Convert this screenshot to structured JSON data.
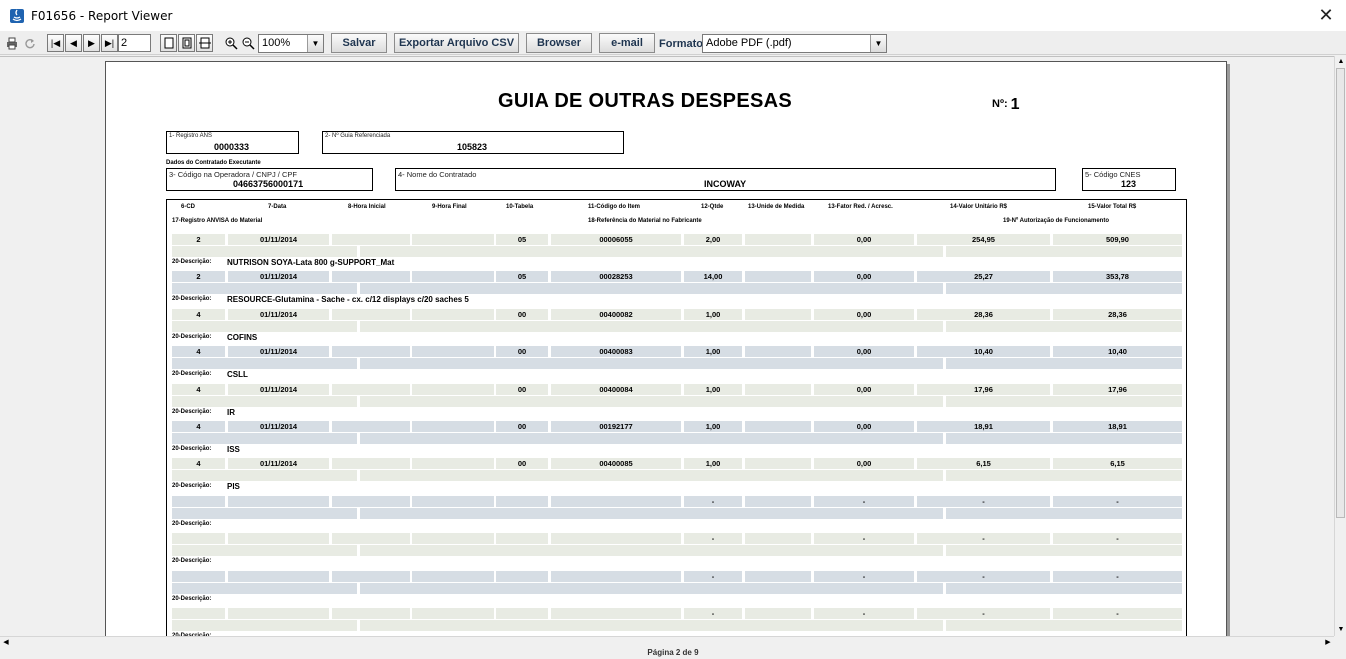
{
  "window": {
    "title": "F01656 - Report Viewer"
  },
  "toolbar": {
    "page_value": "2",
    "zoom_value": "100%",
    "save_label": "Salvar",
    "export_csv_label": "Exportar Arquivo CSV",
    "browser_label": "Browser",
    "email_label": "e-mail",
    "format_label": "Formato:",
    "format_value": "Adobe PDF (.pdf)"
  },
  "report": {
    "title": "GUIA DE OUTRAS DESPESAS",
    "number_label": "Nº:",
    "number_value": "1",
    "registro_ans_label": "1- Registro ANS",
    "registro_ans_value": "0000333",
    "guia_ref_label": "2- Nº Guia Referenciada",
    "guia_ref_value": "105823",
    "contratado_section": "Dados do Contratado Executante",
    "codigo_operadora_label": "3- Código na Operadora / CNPJ / CPF",
    "codigo_operadora_value": "04663756000171",
    "nome_contratado_label": "4- Nome do Contratado",
    "nome_contratado_value": "INCOWAY",
    "cnes_label": "5- Código CNES",
    "cnes_value": "123",
    "headers": {
      "cd": "6-CD",
      "data": "7-Data",
      "hora_ini": "8-Hora Inicial",
      "hora_fim": "9-Hora Final",
      "tabela": "10-Tabela",
      "codigo_item": "11-Código do Item",
      "qtde": "12-Qtde",
      "unidade": "13-Unide de Medida",
      "fator": "13-Fator Red. / Acresc.",
      "valor_unit": "14-Valor Unitário R$",
      "valor_total": "15-Valor Total R$",
      "anvisa": "17-Registro ANVISA do Material",
      "ref_fabricante": "18-Referência do Material no Fabricante",
      "autorizacao": "19-Nº Autorização de Funcionamento"
    },
    "desc_label": "20-Descrição:",
    "items": [
      {
        "cd": "2",
        "data": "01/11/2014",
        "tabela": "05",
        "codigo": "00006055",
        "qtde": "2,00",
        "fator": "0,00",
        "unit": "254,95",
        "total": "509,90",
        "descricao": "NUTRISON SOYA-Lata 800 g-SUPPORT_Mat"
      },
      {
        "cd": "2",
        "data": "01/11/2014",
        "tabela": "05",
        "codigo": "00028253",
        "qtde": "14,00",
        "fator": "0,00",
        "unit": "25,27",
        "total": "353,78",
        "descricao": "RESOURCE-Glutamina - Sache - cx. c/12 displays c/20 saches 5"
      },
      {
        "cd": "4",
        "data": "01/11/2014",
        "tabela": "00",
        "codigo": "00400082",
        "qtde": "1,00",
        "fator": "0,00",
        "unit": "28,36",
        "total": "28,36",
        "descricao": "COFINS"
      },
      {
        "cd": "4",
        "data": "01/11/2014",
        "tabela": "00",
        "codigo": "00400083",
        "qtde": "1,00",
        "fator": "0,00",
        "unit": "10,40",
        "total": "10,40",
        "descricao": "CSLL"
      },
      {
        "cd": "4",
        "data": "01/11/2014",
        "tabela": "00",
        "codigo": "00400084",
        "qtde": "1,00",
        "fator": "0,00",
        "unit": "17,96",
        "total": "17,96",
        "descricao": "IR"
      },
      {
        "cd": "4",
        "data": "01/11/2014",
        "tabela": "00",
        "codigo": "00192177",
        "qtde": "1,00",
        "fator": "0,00",
        "unit": "18,91",
        "total": "18,91",
        "descricao": "ISS"
      },
      {
        "cd": "4",
        "data": "01/11/2014",
        "tabela": "00",
        "codigo": "00400085",
        "qtde": "1,00",
        "fator": "0,00",
        "unit": "6,15",
        "total": "6,15",
        "descricao": "PIS"
      },
      {
        "cd": "",
        "data": "",
        "tabela": "",
        "codigo": "",
        "qtde": "-",
        "fator": "-",
        "unit": "-",
        "total": "-",
        "descricao": ""
      },
      {
        "cd": "",
        "data": "",
        "tabela": "",
        "codigo": "",
        "qtde": "-",
        "fator": "-",
        "unit": "-",
        "total": "-",
        "descricao": ""
      },
      {
        "cd": "",
        "data": "",
        "tabela": "",
        "codigo": "",
        "qtde": "-",
        "fator": "-",
        "unit": "-",
        "total": "-",
        "descricao": ""
      },
      {
        "cd": "",
        "data": "",
        "tabela": "",
        "codigo": "",
        "qtde": "-",
        "fator": "-",
        "unit": "-",
        "total": "-",
        "descricao": ""
      }
    ]
  },
  "status": {
    "page_info": "Página 2 de 9"
  }
}
